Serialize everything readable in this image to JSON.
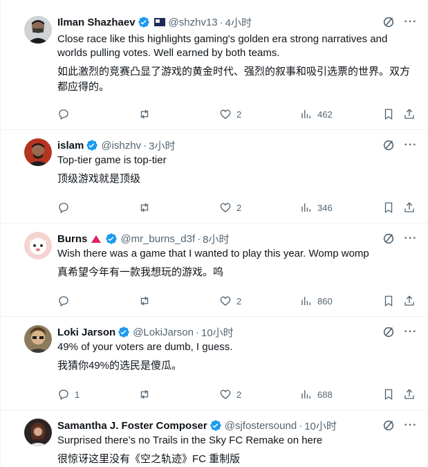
{
  "replies": [
    {
      "name": "Ilman Shazhaev",
      "handle": "@shzhv13",
      "time": "4小时",
      "text": "Close race like this highlights gaming's golden era strong narratives and worlds pulling votes. Well earned by both teams.",
      "translation": "如此激烈的竞赛凸显了游戏的黄金时代、强烈的叙事和吸引选票的世界。双方都应得的。",
      "reply_count": "",
      "repost_count": "",
      "like_count": "2",
      "view_count": "462",
      "avatar_color": "#2a2a2a",
      "has_flag": true,
      "has_triangle": false
    },
    {
      "name": "islam",
      "handle": "@ishzhv",
      "time": "3小时",
      "text": "Top-tier game is top-tier",
      "translation": "顶级游戏就是顶级",
      "reply_count": "",
      "repost_count": "",
      "like_count": "2",
      "view_count": "346",
      "avatar_color": "#7a3b2a",
      "has_flag": false,
      "has_triangle": false
    },
    {
      "name": "Burns",
      "handle": "@mr_burns_d3f",
      "time": "8小时",
      "text": "Wish there was a game that I wanted to play this year. Womp womp",
      "translation": "真希望今年有一款我想玩的游戏。呜",
      "reply_count": "",
      "repost_count": "",
      "like_count": "2",
      "view_count": "860",
      "avatar_color": "#f3c7c2",
      "has_flag": false,
      "has_triangle": true
    },
    {
      "name": "Loki Jarson",
      "handle": "@LokiJarson",
      "time": "10小时",
      "text": "49% of your voters are dumb, I guess.",
      "translation": "我猜你49%的选民是傻瓜。",
      "reply_count": "1",
      "repost_count": "",
      "like_count": "2",
      "view_count": "688",
      "avatar_color": "#6b5a3a",
      "has_flag": false,
      "has_triangle": false
    },
    {
      "name": "Samantha J. Foster Composer",
      "handle": "@sjfostersound",
      "time": "10小时",
      "text": "Surprised there’s no Trails in the Sky FC Remake on here",
      "translation": "很惊讶这里没有《空之轨迹》FC 重制版",
      "reply_count": "",
      "repost_count": "",
      "like_count": "",
      "view_count": "",
      "avatar_color": "#3a2f2f",
      "has_flag": false,
      "has_triangle": false
    }
  ],
  "dot": "·",
  "more_glyph": "···",
  "colors": {
    "verified": "#1d9bf0",
    "muted": "#536471",
    "text": "#0f1419",
    "divider": "#eff3f4"
  },
  "icons": [
    "grok-icon",
    "more-icon",
    "reply-icon",
    "repost-icon",
    "like-icon",
    "views-icon",
    "bookmark-icon",
    "share-icon",
    "verified-badge-icon"
  ]
}
